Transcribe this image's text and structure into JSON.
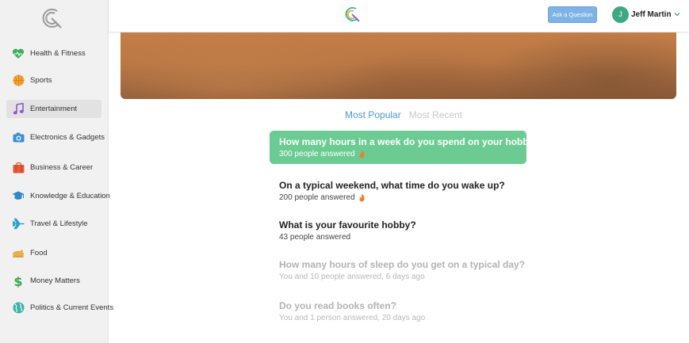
{
  "sidebar": {
    "items": [
      {
        "label": "Health & Fitness",
        "icon": "heart-icon",
        "color": "#3fae5a"
      },
      {
        "label": "Sports",
        "icon": "ball-icon",
        "color": "#f0a534"
      },
      {
        "label": "Entertainment",
        "icon": "music-note-icon",
        "color": "#8a5cc7",
        "active": true
      },
      {
        "label": "Electronics & Gadgets",
        "icon": "camera-icon",
        "color": "#3b8fd8"
      },
      {
        "label": "Business & Career",
        "icon": "briefcase-icon",
        "color": "#e35b3a"
      },
      {
        "label": "Knowledge & Education",
        "icon": "graduation-cap-icon",
        "color": "#2f86c9"
      },
      {
        "label": "Travel & Lifestyle",
        "icon": "airplane-icon",
        "color": "#2aa1c9"
      },
      {
        "label": "Food",
        "icon": "chicken-icon",
        "color": "#e8b04a"
      },
      {
        "label": "Money Matters",
        "icon": "dollar-icon",
        "color": "#3aa64a"
      },
      {
        "label": "Politics & Current Events",
        "icon": "globe-icon",
        "color": "#3cb2a8"
      }
    ]
  },
  "header": {
    "ask_label": "Ask a Question",
    "user_initial": "J",
    "user_name": "Jeff Martin"
  },
  "tabs": [
    {
      "label": "Most Popular",
      "active": true
    },
    {
      "label": "Most Recent",
      "active": false
    }
  ],
  "questions": [
    {
      "title": "How many hours in a week do you spend on your hobby?",
      "meta": "300 people answered",
      "hot": true,
      "state": "highlight"
    },
    {
      "title": "On a typical weekend, what time do you wake up?",
      "meta": "200 people answered",
      "hot": true,
      "state": "normal"
    },
    {
      "title": "What is your favourite hobby?",
      "meta": "43 people answered",
      "hot": false,
      "state": "normal"
    },
    {
      "title": "How many hours of sleep do you get on a typical day?",
      "meta": "You and 10 people answered, 6 days ago",
      "hot": false,
      "state": "faded"
    },
    {
      "title": "Do you read books often?",
      "meta": "You and 1 person answered, 20 days ago",
      "hot": false,
      "state": "faded"
    }
  ],
  "colors": {
    "accent": "#4a9ad6",
    "highlight": "#6ccb93",
    "button": "#7fb3e6",
    "avatar": "#3ea883"
  }
}
